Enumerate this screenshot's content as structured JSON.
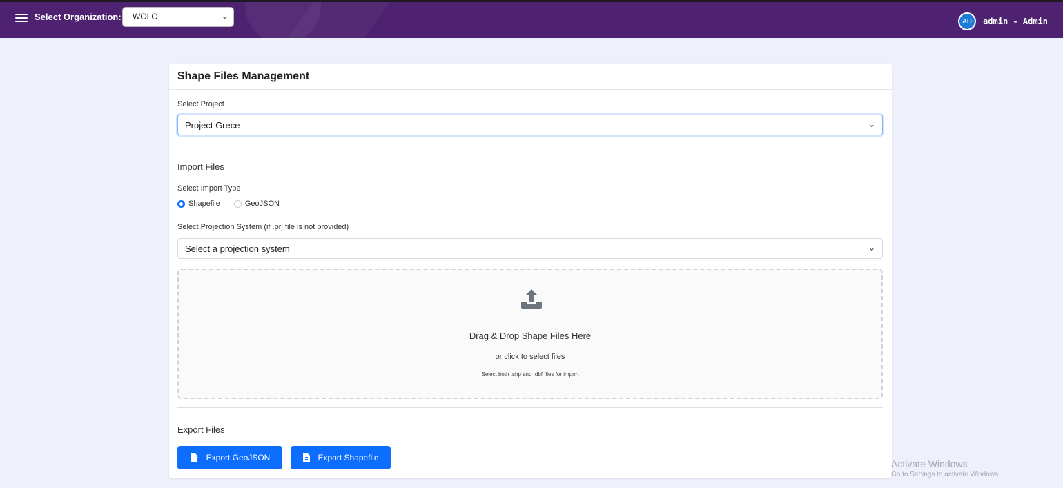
{
  "topbar": {
    "org_label": "Select Organization:",
    "org_value": "WOLO",
    "avatar_initials": "AD",
    "user_name": "admin - Admin",
    "background_color": "#4e2270"
  },
  "card": {
    "title": "Shape Files Management",
    "project_label": "Select Project",
    "project_value": "Project Grece",
    "import_title": "Import Files",
    "import_type_label": "Select Import Type",
    "import_types": [
      {
        "label": "Shapefile",
        "checked": true
      },
      {
        "label": "GeoJSON",
        "checked": false
      }
    ],
    "projection_label": "Select Projection System (if .prj file is not provided)",
    "projection_placeholder": "Select a projection system",
    "dropzone": {
      "icon": "upload-icon",
      "title": "Drag & Drop Shape Files Here",
      "subtitle": "or click to select files",
      "hint": "Select both .shp and .dbf files for import"
    },
    "export_title": "Export Files",
    "export_geojson_label": "Export GeoJSON",
    "export_shapefile_label": "Export Shapefile",
    "accent_color": "#0d6efd"
  },
  "watermark": {
    "line1": "Activate Windows",
    "line2": "Go to Settings to activate Windows."
  }
}
